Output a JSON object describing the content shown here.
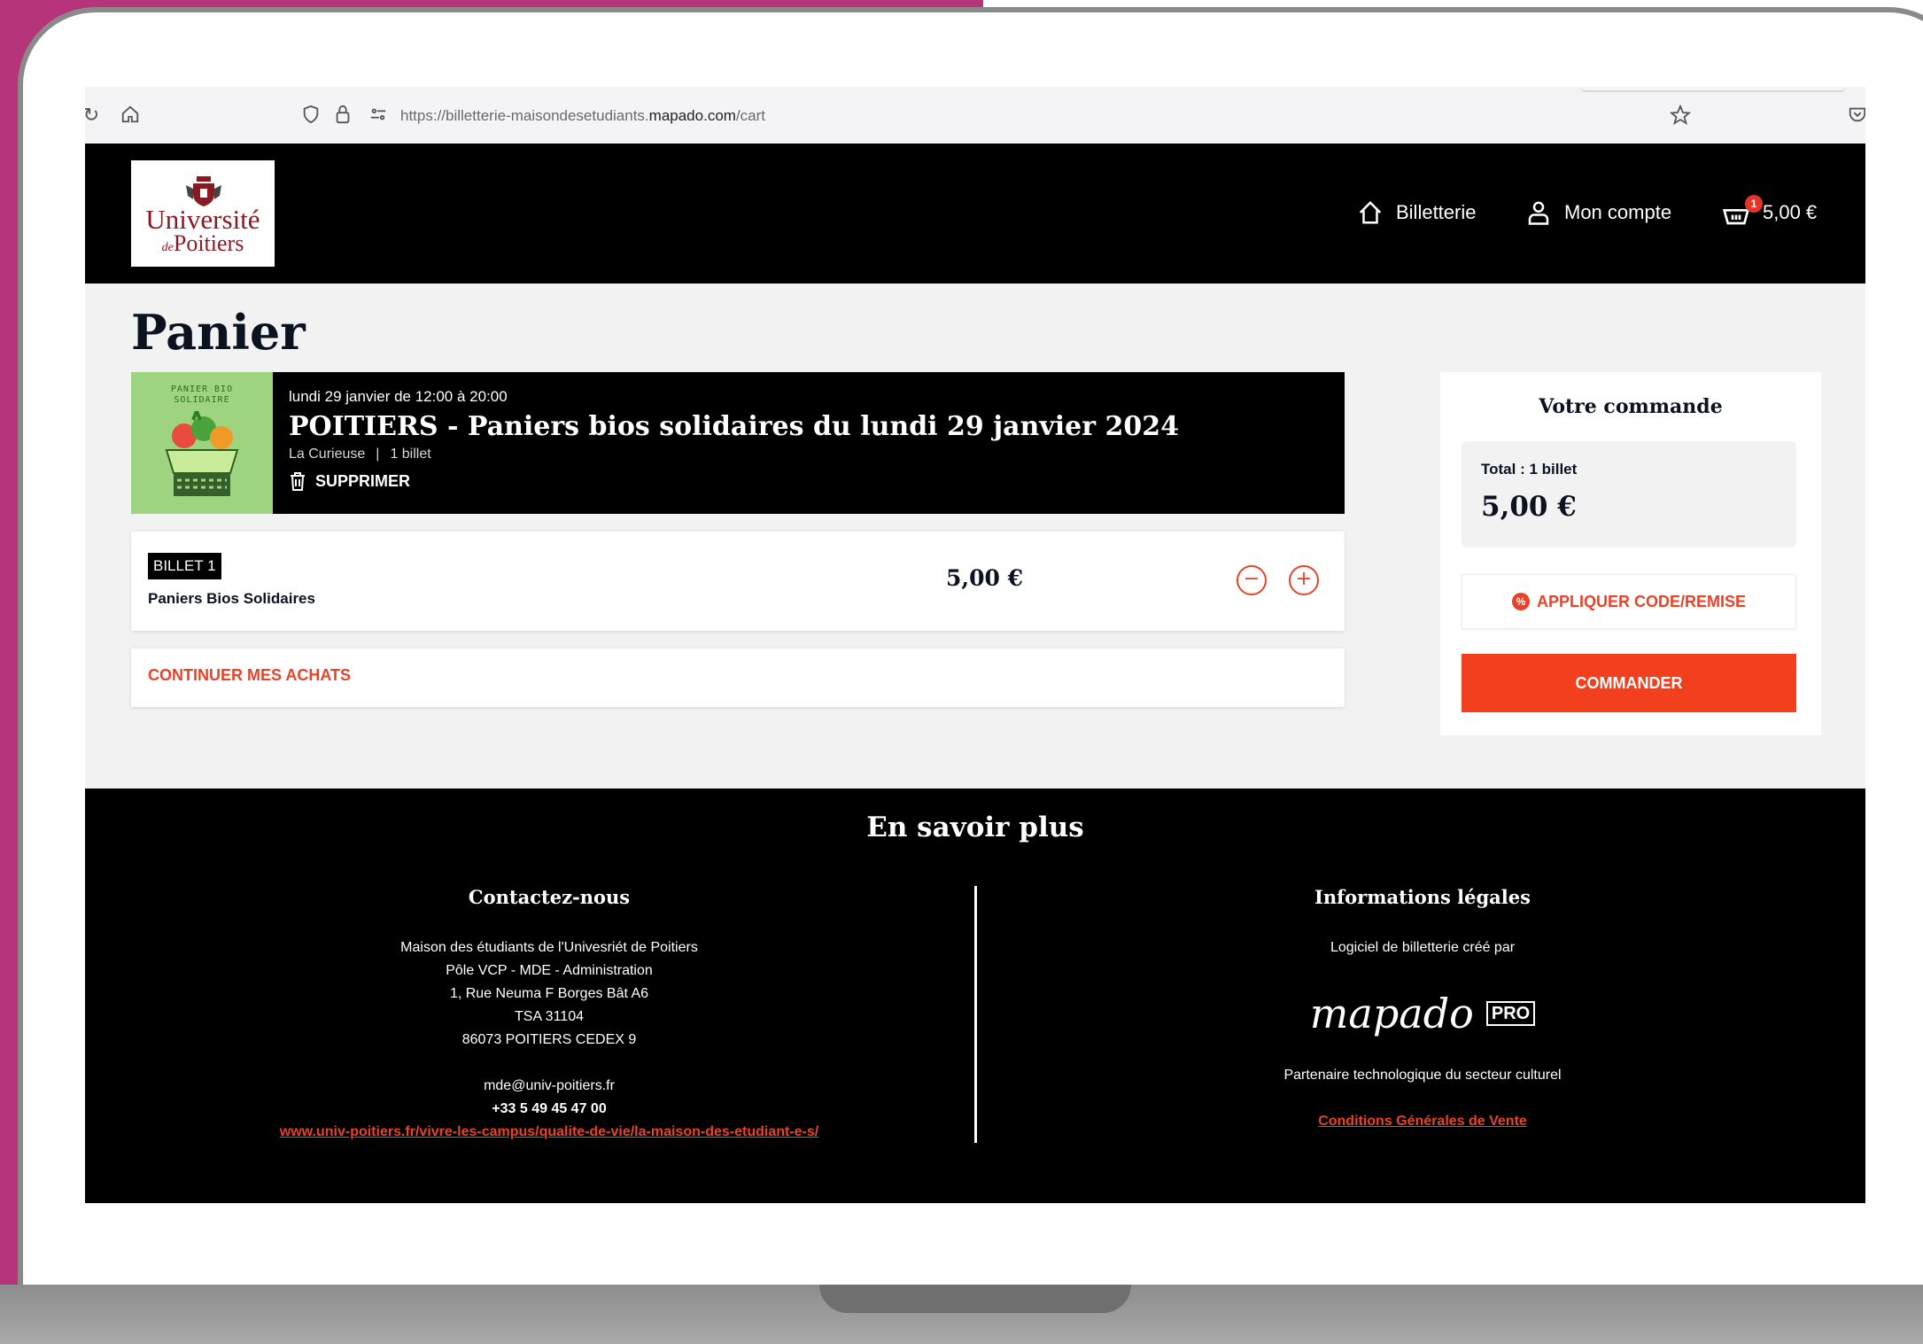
{
  "browser": {
    "url_prefix": "https://billetterie-maisondesetudiants.",
    "url_domain": "mapado.com",
    "url_path": "/cart"
  },
  "header": {
    "logo_line1": "Université",
    "logo_line2_prefix": "de",
    "logo_line2": "Poitiers",
    "nav": {
      "billetterie": "Billetterie",
      "account": "Mon compte",
      "cart_count": "1",
      "cart_total": "5,00 €"
    }
  },
  "cart": {
    "title": "Panier",
    "event": {
      "thumb_label": "PANIER BIO SOLIDAIRE",
      "date": "lundi 29 janvier de 12:00 à 20:00",
      "title": "POITIERS - Paniers bios solidaires du lundi 29 janvier 2024",
      "venue": "La Curieuse",
      "separator": "|",
      "tickets": "1 billet",
      "delete_label": "SUPPRIMER"
    },
    "ticket": {
      "tag": "BILLET 1",
      "name": "Paniers Bios Solidaires",
      "price": "5,00 €",
      "minus": "−",
      "plus": "+"
    },
    "continue_label": "CONTINUER MES ACHATS"
  },
  "order": {
    "title": "Votre commande",
    "total_label": "Total : 1 billet",
    "total_value": "5,00 €",
    "apply_code_label": "APPLIQUER CODE/REMISE",
    "apply_code_icon": "%",
    "order_button": "COMMANDER"
  },
  "footer": {
    "title": "En savoir plus",
    "contact": {
      "title": "Contactez-nous",
      "lines": [
        "Maison des étudiants de l'Univesriét de Poitiers",
        "Pôle VCP - MDE - Administration",
        "1, Rue Neuma F Borges Bât A6",
        "TSA 31104",
        "86073 POITIERS CEDEX 9"
      ],
      "email": "mde@univ-poitiers.fr",
      "phone": "+33 5 49 45 47 00",
      "website": "www.univ-poitiers.fr/vivre-les-campus/qualite-de-vie/la-maison-des-etudiant-e-s/"
    },
    "legal": {
      "title": "Informations légales",
      "created_by": "Logiciel de billetterie créé par",
      "brand": "mapado",
      "brand_badge": "PRO",
      "partner": "Partenaire technologique du secteur culturel",
      "cgv": "Conditions Générales de Vente"
    }
  },
  "colors": {
    "accent": "#e8432a",
    "dark": "#000000",
    "background_magenta": "#b6357a"
  }
}
